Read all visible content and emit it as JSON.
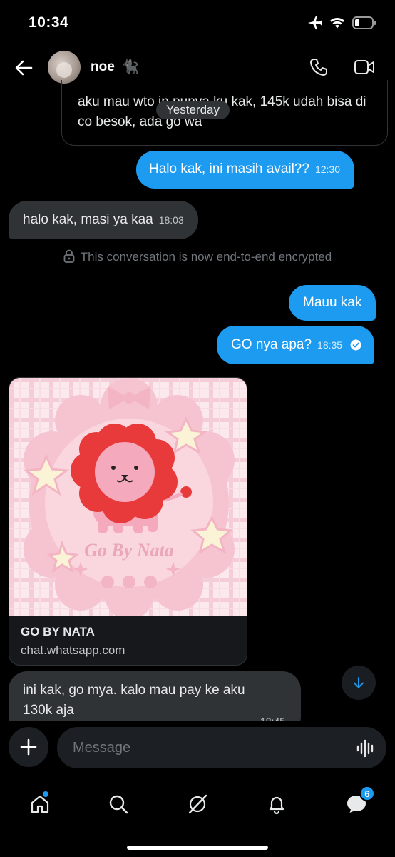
{
  "status_bar": {
    "time": "10:34"
  },
  "header": {
    "name": "noe",
    "name_emoji": "🐈‍⬛"
  },
  "messages": {
    "quoted_text": "aku mau wto in punya ku kak, 145k udah bisa di co besok, ada go wa",
    "date_separator": "Yesterday",
    "m1": {
      "text": "Halo kak, ini masih avail??",
      "time": "12:30"
    },
    "m2": {
      "text": "halo kak, masi ya kaa",
      "time": "18:03"
    },
    "encrypted_notice": "This conversation is now end-to-end encrypted",
    "m3": {
      "text": "Mauu kak"
    },
    "m4": {
      "text": "GO nya apa?",
      "time": "18:35"
    },
    "link_card": {
      "title": "GO BY NATA",
      "url": "chat.whatsapp.com",
      "image_text": "Go By Nata"
    },
    "m5": {
      "text_line1": "ini kak, go mya. kalo mau pay ke aku",
      "text_line2": "130k aja",
      "time": "18:45"
    }
  },
  "composer": {
    "placeholder": "Message"
  },
  "bottom_nav": {
    "items": [
      "home-icon",
      "search-icon",
      "grok-icon",
      "notifications-icon",
      "messages-icon"
    ],
    "messages_badge": "6"
  },
  "colors": {
    "accent": "#1d9bf0",
    "incoming_bubble": "#2f3336",
    "background": "#000000"
  }
}
